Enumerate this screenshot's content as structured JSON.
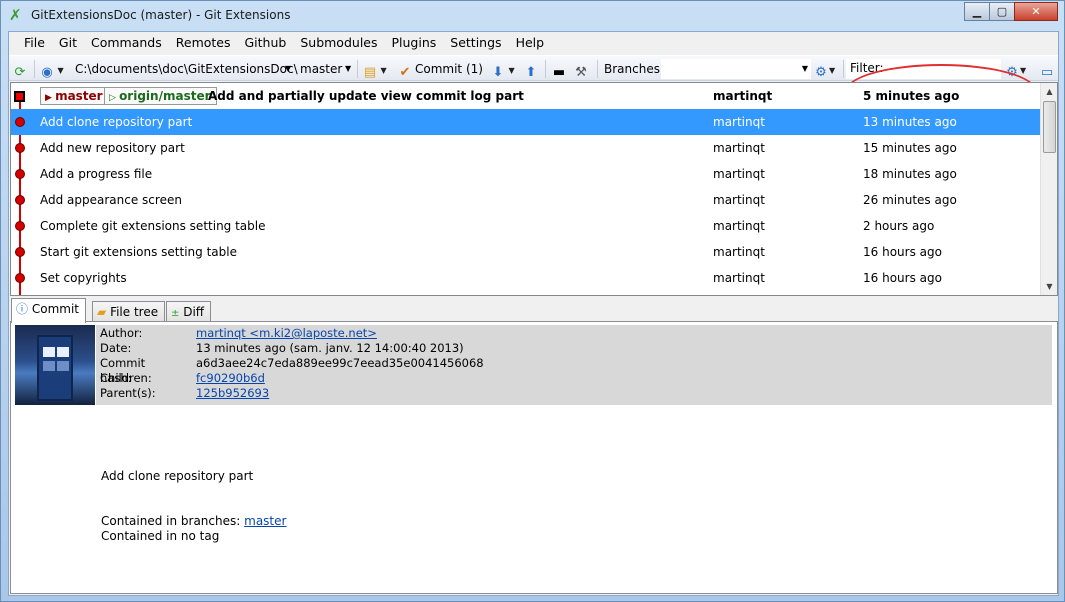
{
  "window": {
    "title": "GitExtensionsDoc (master) - Git Extensions",
    "controls": {
      "minimize": "▁",
      "maximize": "▢",
      "close": "✕"
    }
  },
  "menu": [
    "File",
    "Git",
    "Commands",
    "Remotes",
    "Github",
    "Submodules",
    "Plugins",
    "Settings",
    "Help"
  ],
  "toolbar": {
    "repo_path": "C:\\documents\\doc\\GitExtensionsDoc\\",
    "branch": "master",
    "commit_label": "Commit (1)",
    "branches_label": "Branches:",
    "branches_value": "",
    "filter_label": "Filter:",
    "filter_value": ""
  },
  "revisions": {
    "head": {
      "local_branch": "master",
      "remote_branch": "origin/master",
      "message": "Add and partially update view commit log part",
      "author": "martinqt",
      "date": "5 minutes ago"
    },
    "rows": [
      {
        "message": "Add clone repository part",
        "author": "martinqt",
        "date": "13 minutes ago"
      },
      {
        "message": "Add new repository part",
        "author": "martinqt",
        "date": "15 minutes ago"
      },
      {
        "message": "Add a progress file",
        "author": "martinqt",
        "date": "18 minutes ago"
      },
      {
        "message": "Add appearance screen",
        "author": "martinqt",
        "date": "26 minutes ago"
      },
      {
        "message": "Complete git extensions setting table",
        "author": "martinqt",
        "date": "2 hours ago"
      },
      {
        "message": "Start git extensions setting table",
        "author": "martinqt",
        "date": "16 hours ago"
      },
      {
        "message": "Set copyrights",
        "author": "martinqt",
        "date": "16 hours ago"
      }
    ],
    "selected_index": 0
  },
  "tabs": [
    "Commit",
    "File tree",
    "Diff"
  ],
  "commit": {
    "labels": {
      "author": "Author:",
      "date": "Date:",
      "hash": "Commit hash:",
      "children": "Children:",
      "parents": "Parent(s):"
    },
    "author": "martinqt <m.ki2@laposte.net>",
    "date": "13 minutes ago (sam. janv. 12 14:00:40 2013)",
    "hash": "a6d3aee24c7eda889ee99c7eead35e0041456068",
    "children": "fc90290b6d",
    "parents": "125b952693",
    "message": "Add clone repository part",
    "contained_branches_label": "Contained in branches:",
    "contained_branches_value": "master",
    "contained_tags": "Contained in no tag"
  },
  "colors": {
    "selection": "#3399ff",
    "graph": "#d40000",
    "highlight_ellipse": "#e03030"
  }
}
